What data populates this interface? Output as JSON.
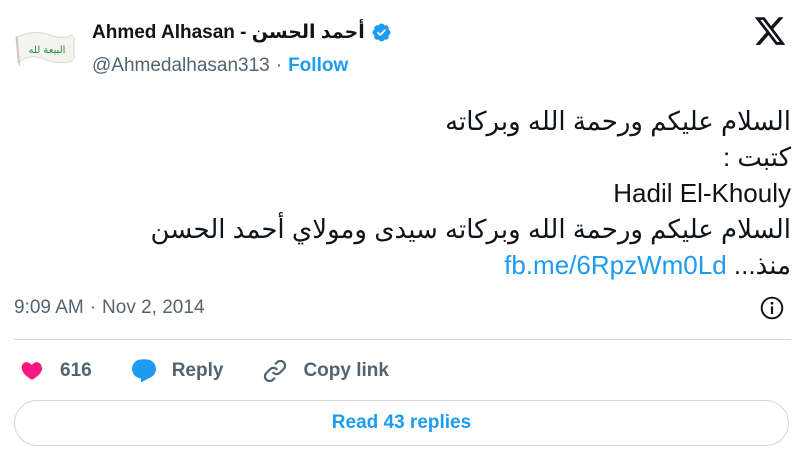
{
  "author": {
    "display_name": "Ahmed Alhasan - أحمد الحسن",
    "handle": "@Ahmedalhasan313",
    "separator": "·",
    "follow_label": "Follow",
    "verified": true,
    "avatar_text": "البيعة لله"
  },
  "tweet": {
    "lines": [
      "السلام عليكم ورحمة الله وبركاته",
      "كتبت :",
      "Hadil El-Khouly",
      "السلام عليكم ورحمة الله وبركاته سيدى ومولاي أحمد الحسن"
    ],
    "last_line_prefix": "منذ...",
    "link_text": "fb.me/6RpzWm0Ld"
  },
  "meta": {
    "time": "9:09 AM",
    "separator": "·",
    "date": "Nov 2, 2014"
  },
  "actions": {
    "like_count": "616",
    "reply_label": "Reply",
    "copy_link_label": "Copy link"
  },
  "read_replies_label": "Read 43 replies",
  "colors": {
    "accent": "#1d9bf0",
    "like": "#f91880",
    "secondary_text": "#536471",
    "border": "#cfd9de"
  }
}
